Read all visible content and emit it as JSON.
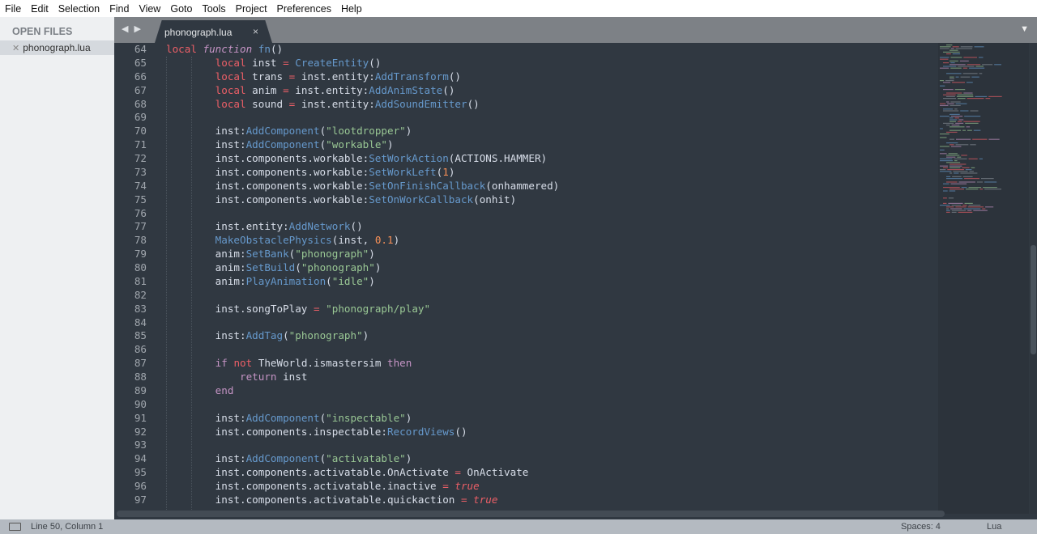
{
  "menu": [
    "File",
    "Edit",
    "Selection",
    "Find",
    "View",
    "Goto",
    "Tools",
    "Project",
    "Preferences",
    "Help"
  ],
  "sidebar": {
    "header": "OPEN FILES",
    "files": [
      "phonograph.lua"
    ]
  },
  "tab": {
    "title": "phonograph.lua",
    "close": "×",
    "nav": "◀ ▶",
    "dropdown": "▼"
  },
  "status": {
    "position": "Line 50, Column 1",
    "spaces": "Spaces: 4",
    "syntax": "Lua"
  },
  "code": [
    {
      "n": 64,
      "t": [
        [
          "kw",
          "local"
        ],
        [
          "plain",
          " "
        ],
        [
          "fnk",
          "function"
        ],
        [
          "plain",
          " "
        ],
        [
          "fn",
          "fn"
        ],
        [
          "pun",
          "()"
        ]
      ]
    },
    {
      "n": 65,
      "t": [
        [
          "plain",
          "        "
        ],
        [
          "kw",
          "local"
        ],
        [
          "plain",
          " inst "
        ],
        [
          "op",
          "="
        ],
        [
          "plain",
          " "
        ],
        [
          "fn",
          "CreateEntity"
        ],
        [
          "pun",
          "()"
        ]
      ]
    },
    {
      "n": 66,
      "t": [
        [
          "plain",
          "        "
        ],
        [
          "kw",
          "local"
        ],
        [
          "plain",
          " trans "
        ],
        [
          "op",
          "="
        ],
        [
          "plain",
          " inst.entity:"
        ],
        [
          "fn",
          "AddTransform"
        ],
        [
          "pun",
          "()"
        ]
      ]
    },
    {
      "n": 67,
      "t": [
        [
          "plain",
          "        "
        ],
        [
          "kw",
          "local"
        ],
        [
          "plain",
          " anim "
        ],
        [
          "op",
          "="
        ],
        [
          "plain",
          " inst.entity:"
        ],
        [
          "fn",
          "AddAnimState"
        ],
        [
          "pun",
          "()"
        ]
      ]
    },
    {
      "n": 68,
      "t": [
        [
          "plain",
          "        "
        ],
        [
          "kw",
          "local"
        ],
        [
          "plain",
          " sound "
        ],
        [
          "op",
          "="
        ],
        [
          "plain",
          " inst.entity:"
        ],
        [
          "fn",
          "AddSoundEmitter"
        ],
        [
          "pun",
          "()"
        ]
      ]
    },
    {
      "n": 69,
      "t": []
    },
    {
      "n": 70,
      "t": [
        [
          "plain",
          "        inst:"
        ],
        [
          "fn",
          "AddComponent"
        ],
        [
          "pun",
          "("
        ],
        [
          "str",
          "\"lootdropper\""
        ],
        [
          "pun",
          ")"
        ]
      ]
    },
    {
      "n": 71,
      "t": [
        [
          "plain",
          "        inst:"
        ],
        [
          "fn",
          "AddComponent"
        ],
        [
          "pun",
          "("
        ],
        [
          "str",
          "\"workable\""
        ],
        [
          "pun",
          ")"
        ]
      ]
    },
    {
      "n": 72,
      "t": [
        [
          "plain",
          "        inst.components.workable:"
        ],
        [
          "fn",
          "SetWorkAction"
        ],
        [
          "pun",
          "(ACTIONS.HAMMER)"
        ]
      ]
    },
    {
      "n": 73,
      "t": [
        [
          "plain",
          "        inst.components.workable:"
        ],
        [
          "fn",
          "SetWorkLeft"
        ],
        [
          "pun",
          "("
        ],
        [
          "num",
          "1"
        ],
        [
          "pun",
          ")"
        ]
      ]
    },
    {
      "n": 74,
      "t": [
        [
          "plain",
          "        inst.components.workable:"
        ],
        [
          "fn",
          "SetOnFinishCallback"
        ],
        [
          "pun",
          "(onhammered)"
        ]
      ]
    },
    {
      "n": 75,
      "t": [
        [
          "plain",
          "        inst.components.workable:"
        ],
        [
          "fn",
          "SetOnWorkCallback"
        ],
        [
          "pun",
          "(onhit)"
        ]
      ]
    },
    {
      "n": 76,
      "t": []
    },
    {
      "n": 77,
      "t": [
        [
          "plain",
          "        inst.entity:"
        ],
        [
          "fn",
          "AddNetwork"
        ],
        [
          "pun",
          "()"
        ]
      ]
    },
    {
      "n": 78,
      "t": [
        [
          "plain",
          "        "
        ],
        [
          "fn",
          "MakeObstaclePhysics"
        ],
        [
          "pun",
          "(inst, "
        ],
        [
          "num",
          "0.1"
        ],
        [
          "pun",
          ")"
        ]
      ]
    },
    {
      "n": 79,
      "t": [
        [
          "plain",
          "        anim:"
        ],
        [
          "fn",
          "SetBank"
        ],
        [
          "pun",
          "("
        ],
        [
          "str",
          "\"phonograph\""
        ],
        [
          "pun",
          ")"
        ]
      ]
    },
    {
      "n": 80,
      "t": [
        [
          "plain",
          "        anim:"
        ],
        [
          "fn",
          "SetBuild"
        ],
        [
          "pun",
          "("
        ],
        [
          "str",
          "\"phonograph\""
        ],
        [
          "pun",
          ")"
        ]
      ]
    },
    {
      "n": 81,
      "t": [
        [
          "plain",
          "        anim:"
        ],
        [
          "fn",
          "PlayAnimation"
        ],
        [
          "pun",
          "("
        ],
        [
          "str",
          "\"idle\""
        ],
        [
          "pun",
          ")"
        ]
      ]
    },
    {
      "n": 82,
      "t": []
    },
    {
      "n": 83,
      "t": [
        [
          "plain",
          "        inst.songToPlay "
        ],
        [
          "op",
          "="
        ],
        [
          "plain",
          " "
        ],
        [
          "str",
          "\"phonograph/play\""
        ]
      ]
    },
    {
      "n": 84,
      "t": []
    },
    {
      "n": 85,
      "t": [
        [
          "plain",
          "        inst:"
        ],
        [
          "fn",
          "AddTag"
        ],
        [
          "pun",
          "("
        ],
        [
          "str",
          "\"phonograph\""
        ],
        [
          "pun",
          ")"
        ]
      ]
    },
    {
      "n": 86,
      "t": []
    },
    {
      "n": 87,
      "t": [
        [
          "plain",
          "        "
        ],
        [
          "ctl",
          "if"
        ],
        [
          "plain",
          " "
        ],
        [
          "kw",
          "not"
        ],
        [
          "plain",
          " TheWorld.ismastersim "
        ],
        [
          "ctl",
          "then"
        ]
      ]
    },
    {
      "n": 88,
      "t": [
        [
          "plain",
          "            "
        ],
        [
          "ctl",
          "return"
        ],
        [
          "plain",
          " inst"
        ]
      ]
    },
    {
      "n": 89,
      "t": [
        [
          "plain",
          "        "
        ],
        [
          "ctl",
          "end"
        ]
      ]
    },
    {
      "n": 90,
      "t": []
    },
    {
      "n": 91,
      "t": [
        [
          "plain",
          "        inst:"
        ],
        [
          "fn",
          "AddComponent"
        ],
        [
          "pun",
          "("
        ],
        [
          "str",
          "\"inspectable\""
        ],
        [
          "pun",
          ")"
        ]
      ]
    },
    {
      "n": 92,
      "t": [
        [
          "plain",
          "        inst.components.inspectable:"
        ],
        [
          "fn",
          "RecordViews"
        ],
        [
          "pun",
          "()"
        ]
      ]
    },
    {
      "n": 93,
      "t": []
    },
    {
      "n": 94,
      "t": [
        [
          "plain",
          "        inst:"
        ],
        [
          "fn",
          "AddComponent"
        ],
        [
          "pun",
          "("
        ],
        [
          "str",
          "\"activatable\""
        ],
        [
          "pun",
          ")"
        ]
      ]
    },
    {
      "n": 95,
      "t": [
        [
          "plain",
          "        inst.components.activatable.OnActivate "
        ],
        [
          "op",
          "="
        ],
        [
          "plain",
          " OnActivate"
        ]
      ]
    },
    {
      "n": 96,
      "t": [
        [
          "plain",
          "        inst.components.activatable.inactive "
        ],
        [
          "op",
          "="
        ],
        [
          "plain",
          " "
        ],
        [
          "bool",
          "true"
        ]
      ]
    },
    {
      "n": 97,
      "t": [
        [
          "plain",
          "        inst.components.activatable.quickaction "
        ],
        [
          "op",
          "="
        ],
        [
          "plain",
          " "
        ],
        [
          "bool",
          "true"
        ]
      ]
    }
  ]
}
